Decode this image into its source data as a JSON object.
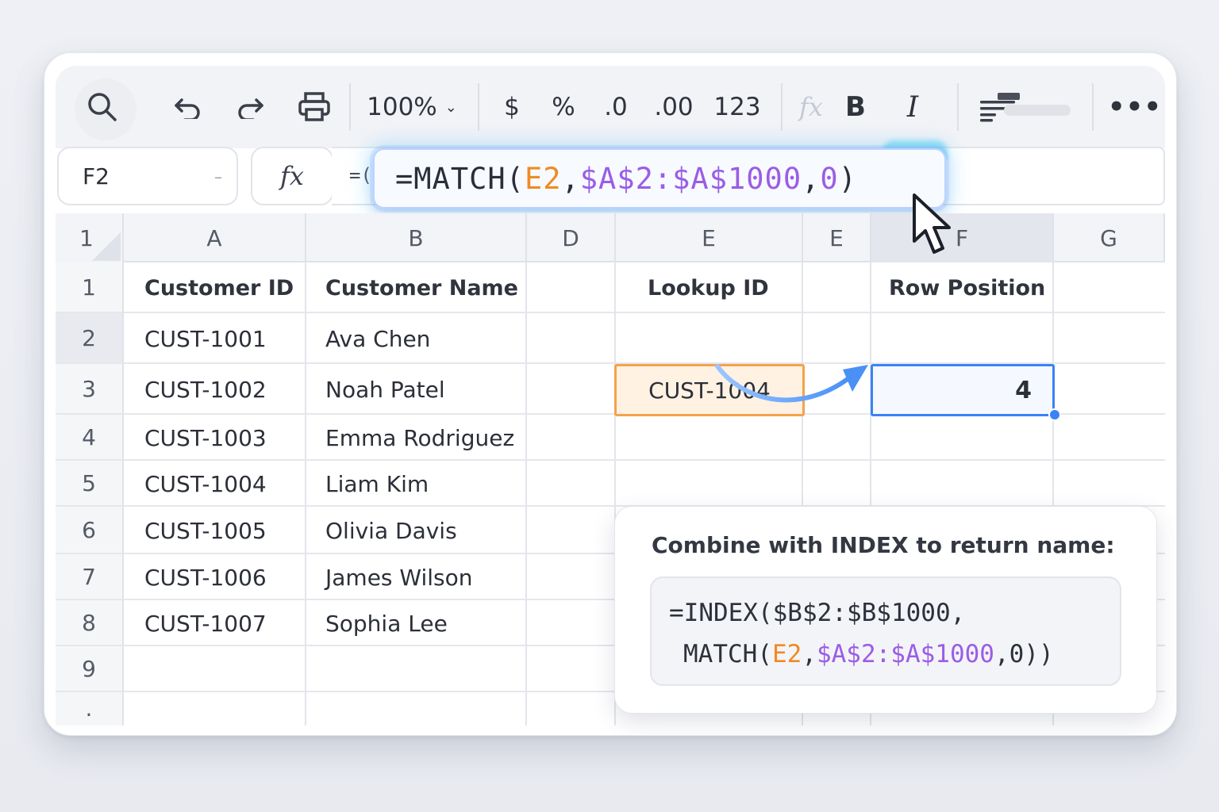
{
  "toolbar": {
    "zoom": "100%",
    "currency": "$",
    "percent": "%",
    "decrease_decimal": ".0",
    "increase_decimal": ".00",
    "number_format": "123",
    "fx": "fx",
    "bold": "B",
    "italic": "I",
    "more": "•••"
  },
  "formula_bar": {
    "cell_ref": "F2",
    "fx_label": "fx",
    "peek_text": "=(",
    "formula_parts": [
      {
        "text": "=MATCH(",
        "color": "default"
      },
      {
        "text": "E2",
        "color": "orange"
      },
      {
        "text": ",",
        "color": "default"
      },
      {
        "text": "$A$2:$A$1000",
        "color": "purple"
      },
      {
        "text": ",",
        "color": "default"
      },
      {
        "text": "0",
        "color": "purple"
      },
      {
        "text": ")",
        "color": "default"
      }
    ]
  },
  "grid": {
    "corner_label": "1",
    "columns": [
      "A",
      "B",
      "D",
      "E",
      "E",
      "F",
      "G"
    ],
    "rows": [
      "1",
      "2",
      "3",
      "4",
      "5",
      "6",
      "7",
      "8",
      "9",
      "·"
    ],
    "header_cells": {
      "a1": "Customer ID",
      "b1": "Customer Name",
      "e1": "Lookup ID",
      "f1": "Row Position"
    },
    "data": [
      {
        "id": "CUST-1001",
        "name": "Ava Chen"
      },
      {
        "id": "CUST-1002",
        "name": "Noah Patel"
      },
      {
        "id": "CUST-1003",
        "name": "Emma Rodriguez"
      },
      {
        "id": "CUST-1004",
        "name": "Liam Kim"
      },
      {
        "id": "CUST-1005",
        "name": "Olivia Davis"
      },
      {
        "id": "CUST-1006",
        "name": "James Wilson"
      },
      {
        "id": "CUST-1007",
        "name": "Sophia Lee"
      }
    ],
    "lookup_value": "CUST-1004",
    "result_value": "4"
  },
  "callout": {
    "title": "Combine with INDEX to return name:",
    "line1": "=INDEX($B$2:$B$1000,",
    "line2_parts": [
      {
        "text": "MATCH(",
        "color": "default"
      },
      {
        "text": "E2",
        "color": "orange"
      },
      {
        "text": ",",
        "color": "default"
      },
      {
        "text": "$A$2:$A$1000",
        "color": "purple"
      },
      {
        "text": ",0))",
        "color": "default"
      }
    ]
  },
  "colors": {
    "accent_blue": "#3b82f6",
    "lookup_orange": "#f5a24b",
    "formula_orange": "#f08a24",
    "formula_purple": "#9b5de5"
  }
}
